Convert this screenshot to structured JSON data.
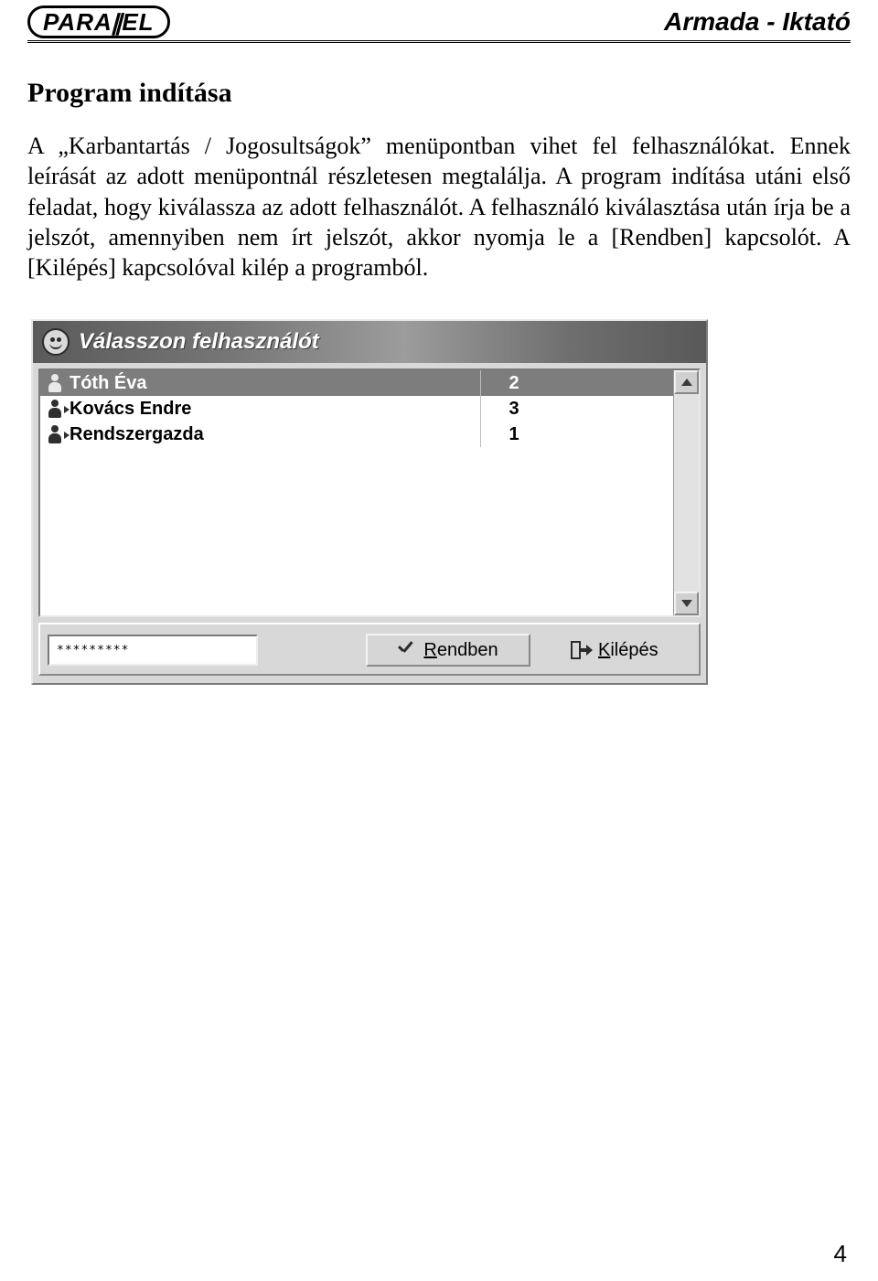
{
  "header": {
    "logo_left": "PARA",
    "logo_bars": "||",
    "logo_right": "EL",
    "doc_title": "Armada - Iktató"
  },
  "section_heading": "Program indítása",
  "body_paragraph": "A „Karbantartás / Jogosultságok” menüpontban vihet fel felhasználókat. Ennek leírását az adott menüpontnál részletesen megtalálja. A program indítása utáni első feladat, hogy kiválassza az adott felhasználót. A felhasználó kiválasztása után írja be a jelszót, amennyiben nem írt jelszót, akkor nyomja le a [Rendben] kapcsolót. A [Kilépés] kapcsolóval kilép a programból.",
  "dialog": {
    "title": "Válasszon felhasználót",
    "users": [
      {
        "name": "Tóth Éva",
        "num": "2",
        "selected": true
      },
      {
        "name": "Kovács Endre",
        "num": "3",
        "selected": false
      },
      {
        "name": "Rendszergazda",
        "num": "1",
        "selected": false
      }
    ],
    "password_mask": "*********",
    "ok_hot": "R",
    "ok_rest": "endben",
    "exit_hot": "K",
    "exit_rest": "ilépés"
  },
  "page_number": "4"
}
